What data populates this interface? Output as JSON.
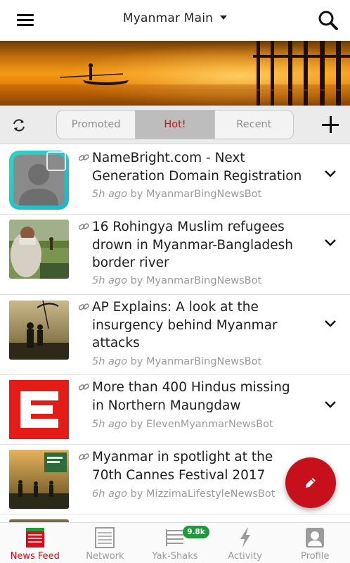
{
  "header": {
    "title": "Myanmar Main",
    "menu_icon": "hamburger-menu-icon",
    "search_icon": "search-icon",
    "dropdown_icon": "chevron-down-icon"
  },
  "filter": {
    "tabs": [
      {
        "label": "Promoted",
        "active": false
      },
      {
        "label": "Hot!",
        "active": true
      },
      {
        "label": "Recent",
        "active": false
      }
    ],
    "refresh_icon": "refresh-icon",
    "add_icon": "plus-icon"
  },
  "feed": {
    "items": [
      {
        "title_lines": [
          "NameBright.com - Next",
          "Generation Domain Registration"
        ],
        "time": "5h ago",
        "by": "by",
        "author": "MyanmarBingNewsBot"
      },
      {
        "title_lines": [
          "16 Rohingya Muslim refugees",
          "drown in Myanmar-Bangladesh",
          "border river"
        ],
        "time": "5h ago",
        "by": "by",
        "author": "MyanmarBingNewsBot"
      },
      {
        "title_lines": [
          "AP Explains: A look at the",
          "insurgency behind Myanmar",
          "attacks"
        ],
        "time": "5h ago",
        "by": "by",
        "author": "MyanmarBingNewsBot"
      },
      {
        "title_lines": [
          "More than 400 Hindus missing",
          "in Northern Maungdaw"
        ],
        "time": "5h ago",
        "by": "by",
        "author": "ElevenMyanmarNewsBot"
      },
      {
        "title_lines": [
          "Myanmar in spotlight at the",
          "70th Cannes Festival 2017"
        ],
        "time": "6h ago",
        "by": "by",
        "author": "MizzimaLifestyleNewsBot"
      }
    ]
  },
  "fab": {
    "icon": "pencil-icon"
  },
  "bottom_nav": {
    "items": [
      {
        "label": "News Feed",
        "icon": "news-feed-icon",
        "active": true
      },
      {
        "label": "Network",
        "icon": "network-icon",
        "active": false
      },
      {
        "label": "Yak-Shaks",
        "icon": "yak-shaks-icon",
        "active": false,
        "badge": "9.8k"
      },
      {
        "label": "Activity",
        "icon": "activity-icon",
        "active": false
      },
      {
        "label": "Profile",
        "icon": "profile-icon",
        "active": false
      }
    ]
  },
  "colors": {
    "accent": "#d80d1a",
    "badge": "#1d9a3a",
    "meta_text": "#9b9b9b"
  }
}
